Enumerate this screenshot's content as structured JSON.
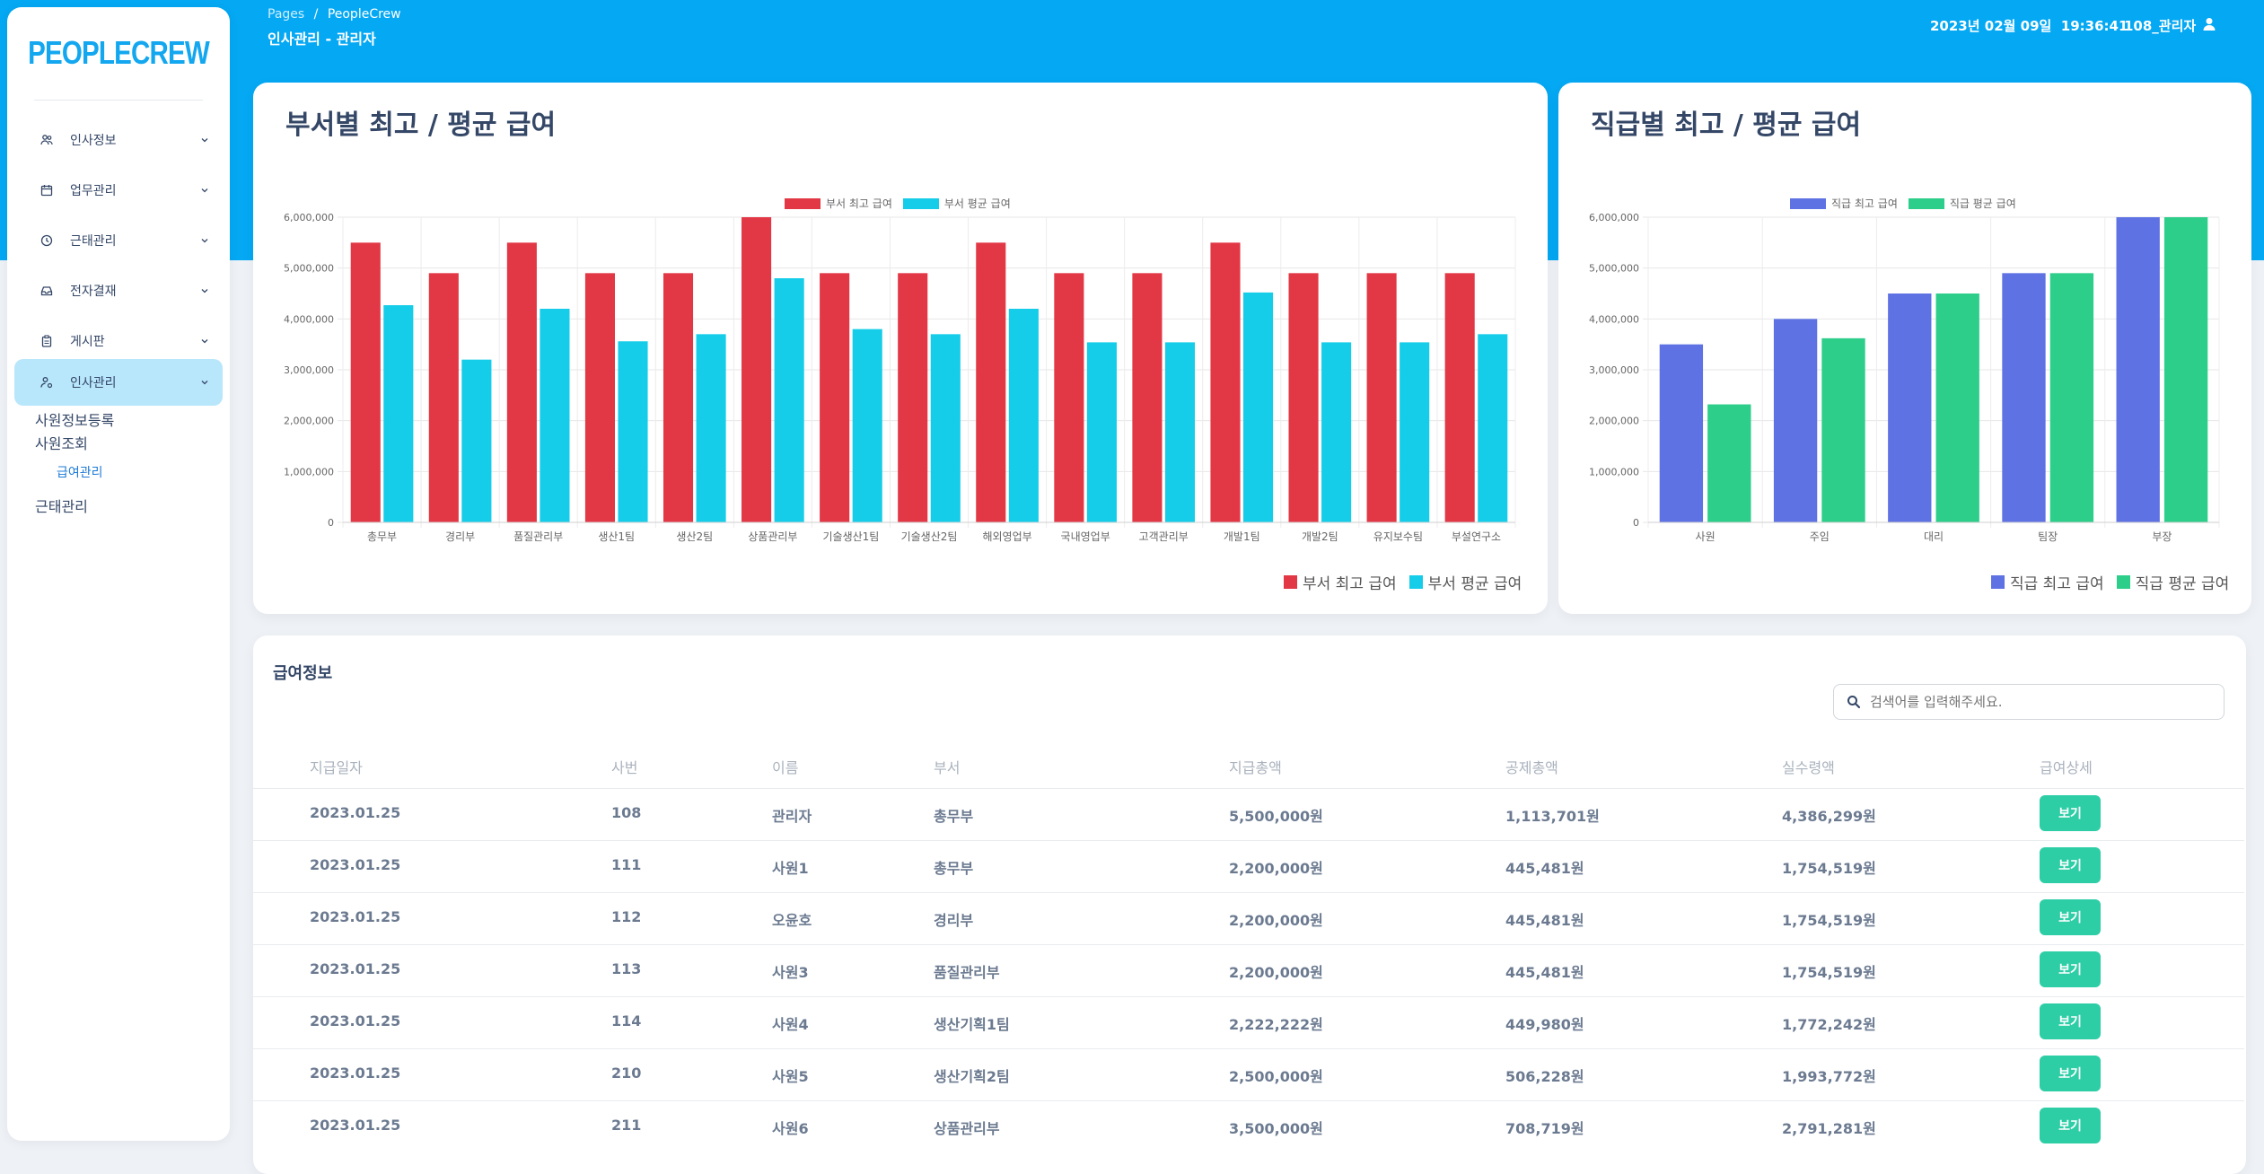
{
  "sidebar": {
    "brand": "PEOPLECREW",
    "items": [
      {
        "label": "인사정보",
        "icon": "people-icon"
      },
      {
        "label": "업무관리",
        "icon": "calendar-icon"
      },
      {
        "label": "근태관리",
        "icon": "clock-icon"
      },
      {
        "label": "전자결재",
        "icon": "tray-icon"
      },
      {
        "label": "게시판",
        "icon": "clipboard-icon"
      },
      {
        "label": "인사관리",
        "icon": "person-settings-icon"
      }
    ],
    "subitems": {
      "employee_register": "사원정보등록",
      "employee_search": "사원조회",
      "salary_manage": "급여관리",
      "attendance_manage": "근태관리"
    }
  },
  "header": {
    "breadcrumb_root": "Pages",
    "breadcrumb_sep": "/",
    "breadcrumb_current": "PeopleCrew",
    "page_title": "인사관리 - 관리자",
    "datetime": "2023년 02월 09일  19:36:41",
    "user": "108_관리자"
  },
  "colors": {
    "accent": "#05a8f3",
    "dept_max": "#e23744",
    "dept_avg": "#15cde8",
    "rank_max": "#5f72e3",
    "rank_avg": "#2dce8a",
    "button": "#2dcea6"
  },
  "chart_data": [
    {
      "type": "bar",
      "title": "부서별 최고 / 평균 급여",
      "categories": [
        "총무부",
        "경리부",
        "품질관리부",
        "생산1팀",
        "생산2팀",
        "상품관리부",
        "기술생산1팀",
        "기술생산2팀",
        "해외영업부",
        "국내영업부",
        "고객관리부",
        "개발1팀",
        "개발2팀",
        "유지보수팀",
        "부설연구소"
      ],
      "series": [
        {
          "name": "부서 최고 급여",
          "values": [
            5500000,
            4900000,
            5500000,
            4900000,
            4900000,
            6000000,
            4900000,
            4900000,
            5500000,
            4900000,
            4900000,
            5500000,
            4900000,
            4900000,
            4900000
          ]
        },
        {
          "name": "부서 평균 급여",
          "values": [
            4270000,
            3200000,
            4200000,
            3560000,
            3700000,
            4800000,
            3800000,
            3700000,
            4200000,
            3540000,
            3540000,
            4520000,
            3540000,
            3540000,
            3700000
          ]
        }
      ],
      "yticks": [
        "0",
        "1,000,000",
        "2,000,000",
        "3,000,000",
        "4,000,000",
        "5,000,000",
        "6,000,000"
      ],
      "ylim": [
        0,
        6000000
      ],
      "legend_placement": "top and bottom-right",
      "grid": true
    },
    {
      "type": "bar",
      "title": "직급별 최고 / 평균 급여",
      "categories": [
        "사원",
        "주임",
        "대리",
        "팀장",
        "부장"
      ],
      "series": [
        {
          "name": "직급 최고 급여",
          "values": [
            3500000,
            4000000,
            4500000,
            4900000,
            6000000
          ]
        },
        {
          "name": "직급 평균 급여",
          "values": [
            2320000,
            3620000,
            4500000,
            4900000,
            6000000
          ]
        }
      ],
      "yticks": [
        "0",
        "1,000,000",
        "2,000,000",
        "3,000,000",
        "4,000,000",
        "5,000,000",
        "6,000,000"
      ],
      "ylim": [
        0,
        6000000
      ],
      "legend_placement": "top and bottom-right",
      "grid": true
    }
  ],
  "salary": {
    "title": "급여정보",
    "search_placeholder": "검색어를 입력해주세요.",
    "columns": [
      "지급일자",
      "사번",
      "이름",
      "부서",
      "지급총액",
      "공제총액",
      "실수령액",
      "급여상세"
    ],
    "button_label": "보기",
    "rows": [
      [
        "2023.01.25",
        "108",
        "관리자",
        "총무부",
        "5,500,000원",
        "1,113,701원",
        "4,386,299원"
      ],
      [
        "2023.01.25",
        "111",
        "사원1",
        "총무부",
        "2,200,000원",
        "445,481원",
        "1,754,519원"
      ],
      [
        "2023.01.25",
        "112",
        "오윤호",
        "경리부",
        "2,200,000원",
        "445,481원",
        "1,754,519원"
      ],
      [
        "2023.01.25",
        "113",
        "사원3",
        "품질관리부",
        "2,200,000원",
        "445,481원",
        "1,754,519원"
      ],
      [
        "2023.01.25",
        "114",
        "사원4",
        "생산기획1팀",
        "2,222,222원",
        "449,980원",
        "1,772,242원"
      ],
      [
        "2023.01.25",
        "210",
        "사원5",
        "생산기획2팀",
        "2,500,000원",
        "506,228원",
        "1,993,772원"
      ],
      [
        "2023.01.25",
        "211",
        "사원6",
        "상품관리부",
        "3,500,000원",
        "708,719원",
        "2,791,281원"
      ]
    ]
  }
}
